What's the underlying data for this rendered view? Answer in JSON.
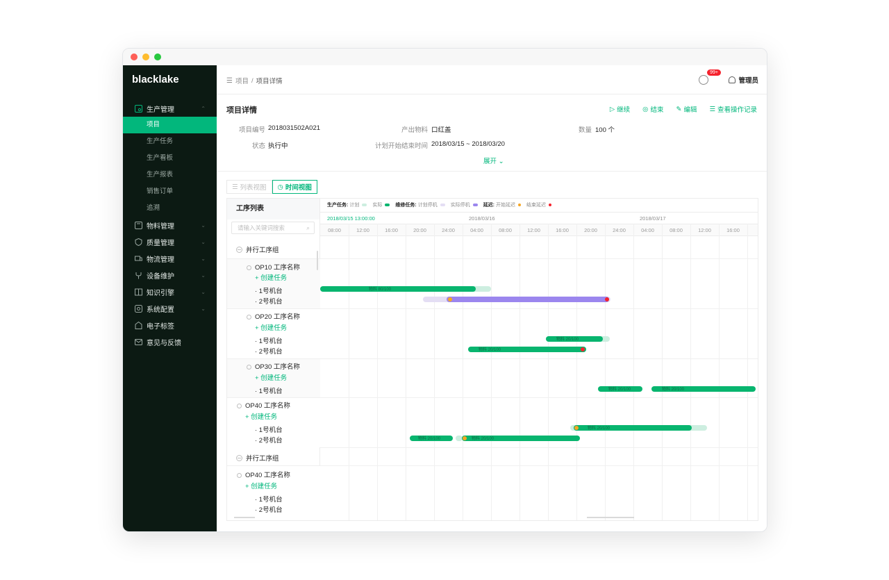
{
  "app": {
    "brand": "blacklake"
  },
  "sidebar": {
    "groups": [
      {
        "label": "生产管理",
        "icon": "factory-icon",
        "expanded": true,
        "items": [
          "项目",
          "生产任务",
          "生产看板",
          "生产报表",
          "销售订单",
          "追溯"
        ],
        "active": "项目"
      },
      {
        "label": "物料管理",
        "icon": "box-icon"
      },
      {
        "label": "质量管理",
        "icon": "shield-icon"
      },
      {
        "label": "物流管理",
        "icon": "truck-icon"
      },
      {
        "label": "设备维护",
        "icon": "wrench-icon"
      },
      {
        "label": "知识引擎",
        "icon": "book-icon"
      },
      {
        "label": "系统配置",
        "icon": "settings-icon"
      },
      {
        "label": "电子标签",
        "icon": "tag-icon"
      },
      {
        "label": "意见与反馈",
        "icon": "mail-icon"
      }
    ]
  },
  "topbar": {
    "breadcrumb": [
      "项目",
      "项目详情"
    ],
    "notification_count": "99+",
    "user": "管理员"
  },
  "detail": {
    "title": "项目详情",
    "actions": [
      "继续",
      "结束",
      "编辑",
      "查看操作记录"
    ],
    "fields": {
      "project_no_label": "项目编号",
      "project_no": "2018031502A021",
      "material_label": "产出物料",
      "material": "口红盖",
      "qty_label": "数量",
      "qty": "100 个",
      "status_label": "状态",
      "status": "执行中",
      "plan_label": "计划开始结束时间",
      "plan": "2018/03/15 ~ 2018/03/20"
    },
    "expand": "展开"
  },
  "view_toggle": {
    "list": "列表视图",
    "timeline": "时间视图",
    "active": "时间视图"
  },
  "gantt": {
    "left_header": "工序列表",
    "search_placeholder": "请输入关键词搜索",
    "legend": {
      "prod_label": "生产任务:",
      "plan": "计划",
      "actual": "实际",
      "maint_label": "维修任务:",
      "maint_plan": "计划停机",
      "maint_actual": "实际停机",
      "delay_label": "延迟:",
      "start_delay": "开始延迟",
      "end_delay": "结束延迟",
      "colors": {
        "plan": "#cdeee0",
        "actual": "#08b56f",
        "maint_plan": "#e4def4",
        "maint_actual": "#9b86ee",
        "start_delay": "#f5a623",
        "end_delay": "#f5222d"
      }
    },
    "current_time": "2018/03/15 13:00:00",
    "dates": [
      "2018/03/16",
      "2018/03/17"
    ],
    "ticks": [
      "08:00",
      "12:00",
      "16:00",
      "20:00",
      "24:00",
      "04:00",
      "08:00",
      "12:00",
      "16:00",
      "20:00",
      "24:00",
      "04:00",
      "08:00",
      "12:00",
      "16:00"
    ],
    "rows": {
      "group1": "并行工序组",
      "op10": "OP10 工序名称",
      "op20": "OP20 工序名称",
      "op30": "OP30 工序名称",
      "op40": "OP40 工序名称",
      "group2": "并行工序组",
      "op40b": "OP40 工序名称",
      "create": "+ 创建任务",
      "m1": "· 1号机台",
      "m2": "· 2号机台"
    },
    "bar_labels": {
      "a": "物料 80/100",
      "b": "物料 20/100",
      "c": "物料 20/100",
      "d": "物料 20/100",
      "e": "物料 20/100",
      "f": "物料 20/100",
      "g": "物料 20/100",
      "h": "物料 20/100"
    }
  }
}
